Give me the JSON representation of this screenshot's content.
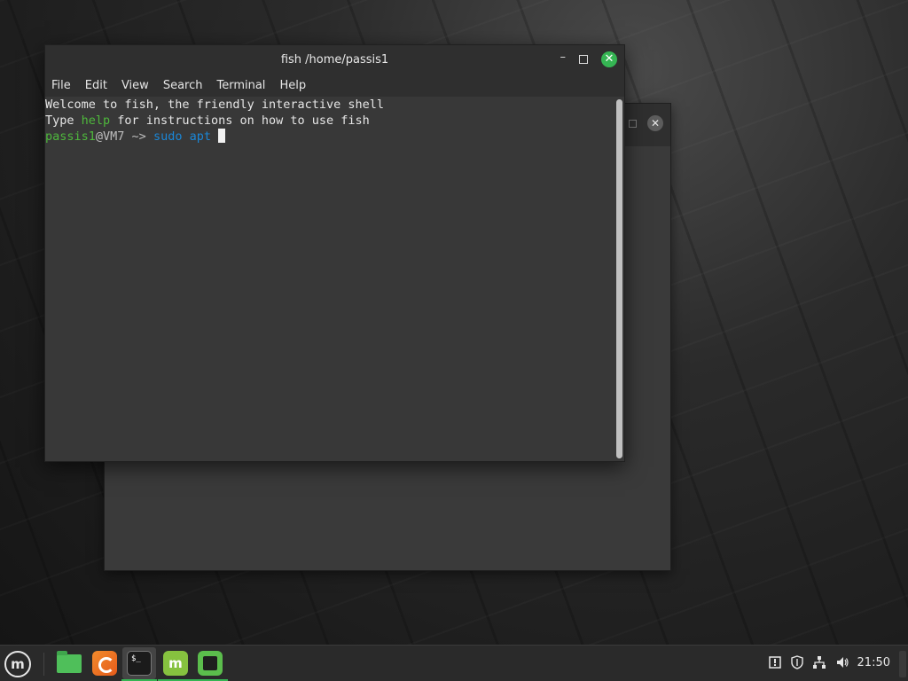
{
  "terminal_window": {
    "title": "fish /home/passis1",
    "menu": [
      "File",
      "Edit",
      "View",
      "Search",
      "Terminal",
      "Help"
    ],
    "lines": {
      "welcome": "Welcome to fish, the friendly interactive shell",
      "type_pre": "Type ",
      "type_help": "help",
      "type_post": " for instructions on how to use fish",
      "prompt_user": "passis1",
      "prompt_host": "@VM7 ~> ",
      "cmd_sudo": "sudo",
      "cmd_apt": " apt "
    }
  },
  "taskbar": {
    "menu_label": "m",
    "apps": [
      "files",
      "firefox",
      "terminal",
      "mintupdate",
      "app"
    ],
    "terminal_icon_text": "$_",
    "mint_icon_text": "m",
    "clock": "21:50",
    "tray_icons": [
      "notification-icon",
      "shield-icon",
      "network-icon",
      "volume-icon"
    ]
  },
  "colors": {
    "accent": "#35b553",
    "prompt_green": "#4eb83c",
    "command_blue": "#1a86d6"
  }
}
